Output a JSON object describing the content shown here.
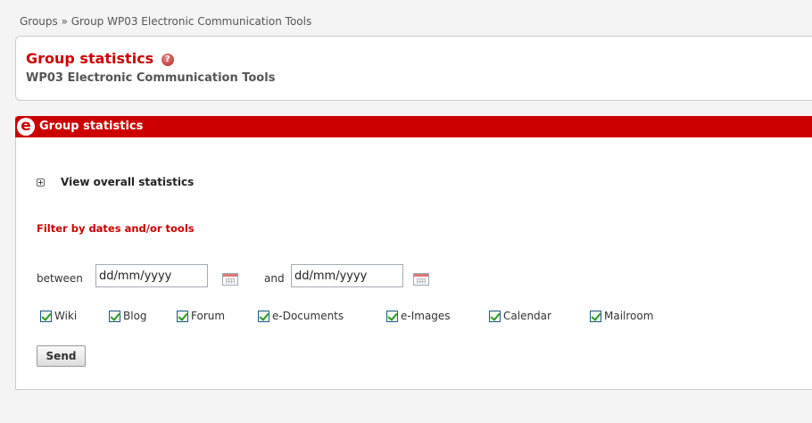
{
  "breadcrumb": {
    "text": "Groups » Group WP03 Electronic Communication Tools"
  },
  "header": {
    "title": "Group statistics",
    "help_icon": "?",
    "subtitle": "WP03 Electronic Communication Tools"
  },
  "panel": {
    "logo_letter": "e",
    "title": "Group statistics",
    "view_overall": "View overall statistics",
    "filter_title": "Filter by dates and/or tools",
    "between_label": "between",
    "and_label": "and",
    "date_from_value": "dd/mm/yyyy",
    "date_to_value": "dd/mm/yyyy",
    "tools": [
      {
        "label": "Wiki",
        "checked": true
      },
      {
        "label": "Blog",
        "checked": true
      },
      {
        "label": "Forum",
        "checked": true
      },
      {
        "label": "e-Documents",
        "checked": true
      },
      {
        "label": "e-Images",
        "checked": true
      },
      {
        "label": "Calendar",
        "checked": true
      },
      {
        "label": "Mailroom",
        "checked": true
      }
    ],
    "send_label": "Send"
  },
  "colors": {
    "brand_red": "#cc0000",
    "background": "#f4f4f4"
  }
}
